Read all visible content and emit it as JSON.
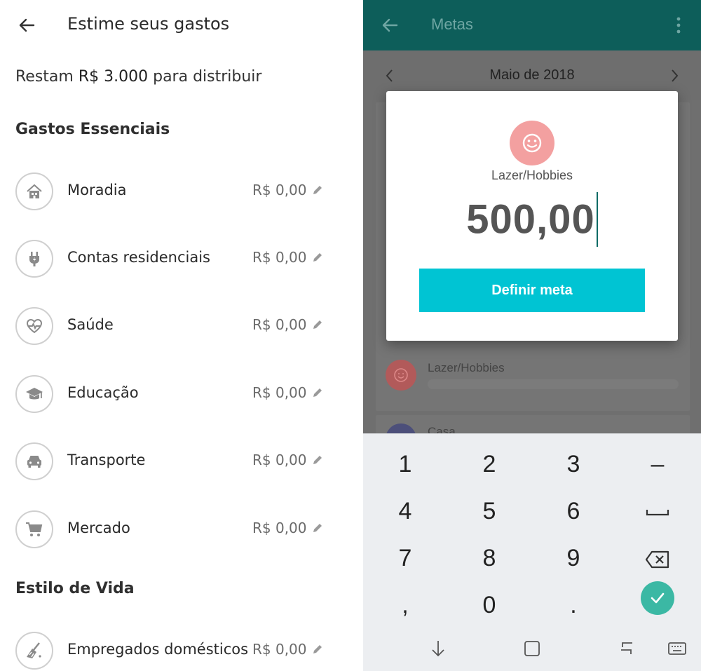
{
  "left": {
    "header": {
      "title": "Estime seus gastos",
      "back_icon": "arrow-left-icon"
    },
    "remaining": {
      "prefix": "Restam",
      "amount": "R$ 3.000",
      "suffix": "para distribuir"
    },
    "sections": [
      {
        "title": "Gastos Essenciais",
        "items": [
          {
            "label": "Moradia",
            "value": "R$ 0,00",
            "icon": "house-icon"
          },
          {
            "label": "Contas residenciais",
            "value": "R$ 0,00",
            "icon": "plug-icon"
          },
          {
            "label": "Saúde",
            "value": "R$ 0,00",
            "icon": "heart-pulse-icon"
          },
          {
            "label": "Educação",
            "value": "R$ 0,00",
            "icon": "graduation-cap-icon"
          },
          {
            "label": "Transporte",
            "value": "R$ 0,00",
            "icon": "car-icon"
          },
          {
            "label": "Mercado",
            "value": "R$ 0,00",
            "icon": "cart-icon"
          }
        ]
      },
      {
        "title": "Estilo de Vida",
        "items": [
          {
            "label": "Empregados domésticos",
            "value": "R$ 0,00",
            "icon": "broom-icon"
          }
        ]
      }
    ]
  },
  "right": {
    "header": {
      "title": "Metas",
      "back_icon": "arrow-left-icon",
      "menu_icon": "more-vertical-icon"
    },
    "month": {
      "label": "Maio de 2018"
    },
    "background_list": [
      {
        "label": "Lazer/Hobbies",
        "color": "#b25a5a"
      },
      {
        "label": "Casa",
        "color": "#4c4f7a"
      }
    ],
    "dialog": {
      "category": "Lazer/Hobbies",
      "category_icon": "smiley-icon",
      "icon_color": "#f3a0a0",
      "value": "500,00",
      "button_label": "Definir meta",
      "button_color": "#00c4d3"
    },
    "keyboard": {
      "rows": [
        [
          "1",
          "2",
          "3",
          "–"
        ],
        [
          "4",
          "5",
          "6",
          "space"
        ],
        [
          "7",
          "8",
          "9",
          "backspace"
        ],
        [
          ",",
          "0",
          ".",
          "confirm"
        ]
      ],
      "keys": {
        "k1": "1",
        "k2": "2",
        "k3": "3",
        "k4": "4",
        "k5": "5",
        "k6": "6",
        "k7": "7",
        "k8": "8",
        "k9": "9",
        "k0": "0",
        "comma": ",",
        "dot": ".",
        "minus": "–"
      },
      "nav_icons": [
        "down-arrow-icon",
        "recent-apps-icon",
        "back-icon",
        "keyboard-icon"
      ]
    }
  },
  "colors": {
    "header_teal": "#0d5e5a",
    "accent_cyan": "#00c4d3",
    "confirm_green": "#3bb8a4"
  }
}
